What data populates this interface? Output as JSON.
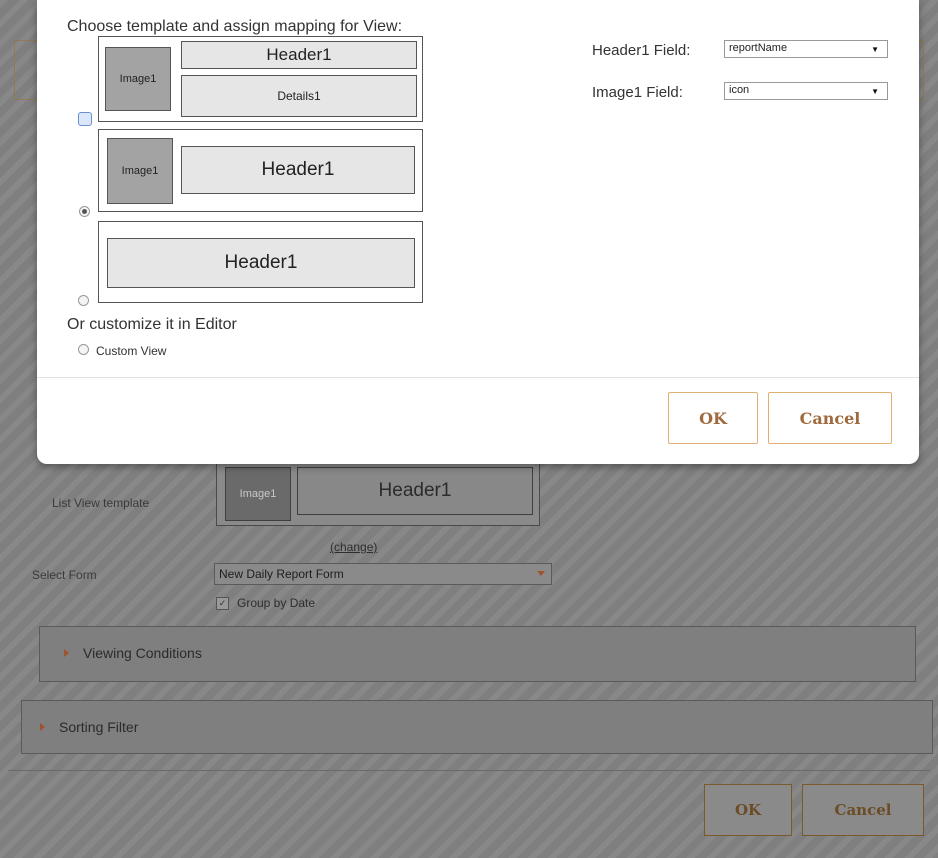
{
  "background": {
    "list_view_label": "List View template",
    "mini_template": {
      "image": "Image1",
      "header": "Header1"
    },
    "change_link": "(change)",
    "select_form_label": "Select Form",
    "select_form_value": "New Daily Report Form",
    "group_by_date_label": "Group by Date",
    "viewing_conditions": "Viewing Conditions",
    "sorting_filter": "Sorting Filter",
    "ok_label": "OK",
    "cancel_label": "Cancel"
  },
  "modal": {
    "title": "Choose template and assign mapping for View:",
    "templates": [
      {
        "image": "Image1",
        "header": "Header1",
        "details": "Details1"
      },
      {
        "image": "Image1",
        "header": "Header1"
      },
      {
        "header": "Header1"
      }
    ],
    "custom_title": "Or customize it in Editor",
    "custom_view_label": "Custom View",
    "header_field_label": "Header1 Field:",
    "header_field_value": "reportName",
    "image_field_label": "Image1 Field:",
    "image_field_value": "icon",
    "ok_label": "OK",
    "cancel_label": "Cancel"
  },
  "colors": {
    "accent": "#a06a3c",
    "button_border": "#e0b070",
    "overlay": "#7f7f7f"
  }
}
